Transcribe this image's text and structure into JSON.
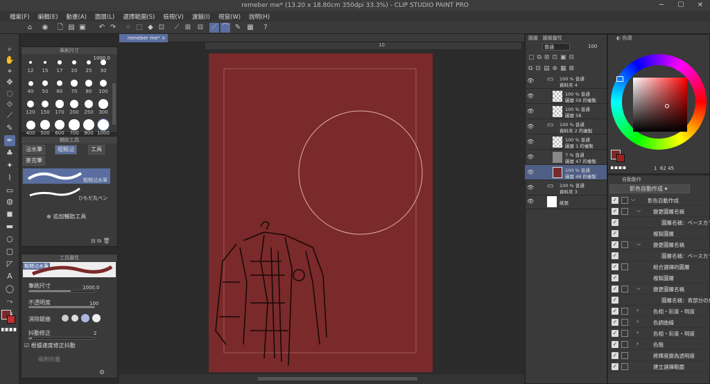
{
  "window": {
    "title": "remeber me* (13.20 x 18.80cm 350dpi 33.3%) - CLIP STUDIO PAINT PRO"
  },
  "menu": [
    "檔案(F)",
    "編輯(E)",
    "動畫(A)",
    "圖層(L)",
    "選擇範圍(S)",
    "檢視(V)",
    "濾鏡(I)",
    "視窗(W)",
    "說明(H)"
  ],
  "doc_tab": "remeber me*",
  "brush_size_panel": {
    "title": "筆刷尺寸",
    "value": "1000.0",
    "sizes": [
      "12",
      "15",
      "17",
      "20",
      "25",
      "30",
      "40",
      "50",
      "60",
      "70",
      "80",
      "100",
      "120",
      "150",
      "170",
      "200",
      "250",
      "300",
      "400",
      "500",
      "600",
      "700",
      "800",
      "1000"
    ]
  },
  "subtool_panel": {
    "title": "輔助工具",
    "tabs": [
      "沾水筆",
      "粗糙沾",
      "工具",
      "麥克筆"
    ],
    "brushes": [
      "粗糙沾水筆",
      "ひもだ丸ペン"
    ],
    "add_label": "追加輔助工具"
  },
  "tool_property": {
    "title": "工具屬性",
    "name": "粗糙沾水筆",
    "size_label": "筆刷尺寸",
    "size_value": "1000.0",
    "opacity_label": "不透明度",
    "opacity_value": "100",
    "aa_label": "消除鋸齒",
    "stab_label": "抖動修正",
    "stab_value": "2",
    "speed_label": "根據速度修正抖動",
    "snap_label": "吸附向量"
  },
  "ruler": {
    "mark": "10"
  },
  "layer_panel": {
    "tabs": [
      "圖層",
      "圖層屬性"
    ],
    "blend": "普通",
    "opacity": "100",
    "layers": [
      {
        "line1": "100 % 普通",
        "line2": "資料夾 4"
      },
      {
        "line1": "100 % 普通",
        "line2": "圖層 59 的複製"
      },
      {
        "line1": "100 % 普通",
        "line2": "圖層 58"
      },
      {
        "line1": "100 % 普通",
        "line2": "資料夾 2 的複製"
      },
      {
        "line1": "100 % 普通",
        "line2": "圖層 1 的複製"
      },
      {
        "line1": "7 % 普通",
        "line2": "圖層 47 的複製"
      },
      {
        "line1": "100 % 普通",
        "line2": "圖層 48 的複製"
      },
      {
        "line1": "100 % 普通",
        "line2": "資料夾 3"
      },
      {
        "line1": "",
        "line2": "紙張"
      }
    ]
  },
  "color_panel": {
    "title": "色環",
    "h": "1",
    "s": "62",
    "v": "45",
    "main_color": "#7a2a2a"
  },
  "auto_action": {
    "title": "自動動作",
    "set": "影色自動作成",
    "items": [
      "影色自動作成",
      "變更圖層名稱",
      "圖層名稱：ベースカラ",
      "複製圖層",
      "變更圖層名稱",
      "圖層名稱：ベースカラ",
      "組合選擇的圖層",
      "複製圖層",
      "變更圖層名稱",
      "圖層名稱：青部分の色",
      "色相・彩度・明度",
      "色調曲線",
      "色相・彩度・明度",
      "色階",
      "將輝度變為透明度",
      "建立選擇範圍"
    ]
  }
}
